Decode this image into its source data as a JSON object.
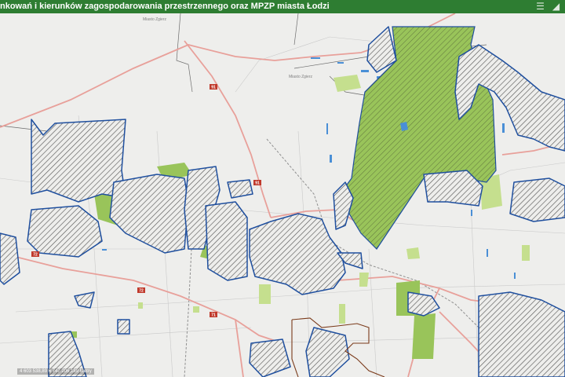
{
  "header": {
    "title": "nkowań i kierunków zagospodarowania przestrzennego oraz MPZP miasta Łodzi",
    "list_icon": "list-icon",
    "layers_icon": "layers-icon",
    "color": "#2e7d32"
  },
  "map": {
    "place_labels": [
      "Miasto Zgierz",
      "Miasto Zgierz"
    ],
    "road_shields": [
      "91",
      "91",
      "72",
      "72",
      "71"
    ],
    "colors": {
      "background": "#eeeeec",
      "plan_outline": "#1f4f9e",
      "hatch": "#5a5a5a",
      "green_area": "#99c45a",
      "light_green": "#c5df8e",
      "road": "#e8a09a",
      "boundary": "#7a3a1a",
      "water": "#4a8fd6"
    }
  },
  "coordinates": {
    "text": "4 603 538,89 6 747 206,189 Metry"
  }
}
